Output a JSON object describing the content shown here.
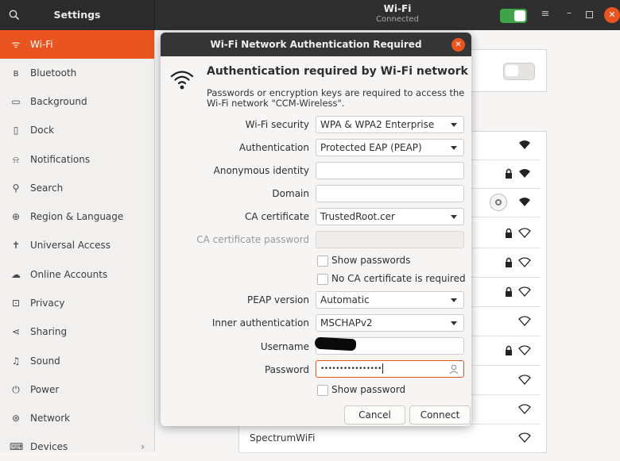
{
  "header": {
    "settings_title": "Settings",
    "window_title": "Wi-Fi",
    "window_subtitle": "Connected",
    "menu_glyph": "≡",
    "minimize_glyph": "–",
    "close_glyph": "✕"
  },
  "sidebar": {
    "items": [
      {
        "label": "Wi-Fi",
        "icon": "wifi-icon",
        "glyph": "ᯤ"
      },
      {
        "label": "Bluetooth",
        "icon": "bluetooth-icon",
        "glyph": "ʙ"
      },
      {
        "label": "Background",
        "icon": "background-icon",
        "glyph": "▭"
      },
      {
        "label": "Dock",
        "icon": "dock-icon",
        "glyph": "▯"
      },
      {
        "label": "Notifications",
        "icon": "bell-icon",
        "glyph": "⍾"
      },
      {
        "label": "Search",
        "icon": "search-icon",
        "glyph": "⚲"
      },
      {
        "label": "Region & Language",
        "icon": "globe-icon",
        "glyph": "⊕"
      },
      {
        "label": "Universal Access",
        "icon": "accessibility-icon",
        "glyph": "✝"
      },
      {
        "label": "Online Accounts",
        "icon": "cloud-icon",
        "glyph": "☁"
      },
      {
        "label": "Privacy",
        "icon": "privacy-icon",
        "glyph": "⊡"
      },
      {
        "label": "Sharing",
        "icon": "share-icon",
        "glyph": "⋖"
      },
      {
        "label": "Sound",
        "icon": "music-icon",
        "glyph": "♫"
      },
      {
        "label": "Power",
        "icon": "power-icon",
        "glyph": "⏻"
      },
      {
        "label": "Network",
        "icon": "network-icon",
        "glyph": "⊛"
      },
      {
        "label": "Devices",
        "icon": "devices-icon",
        "glyph": "⌨"
      }
    ],
    "chevron": "›"
  },
  "background_network": {
    "last_visible_network": "SpectrumWiFi"
  },
  "dialog": {
    "title": "Wi-Fi Network Authentication Required",
    "heading": "Authentication required by Wi-Fi network",
    "description": "Passwords or encryption keys are required to access the Wi-Fi network \"CCM-Wireless\".",
    "fields": {
      "wifi_security": {
        "label": "Wi-Fi security",
        "value": "WPA & WPA2 Enterprise"
      },
      "authentication": {
        "label": "Authentication",
        "value": "Protected EAP (PEAP)"
      },
      "anonymous_identity": {
        "label": "Anonymous identity",
        "value": ""
      },
      "domain": {
        "label": "Domain",
        "value": ""
      },
      "ca_certificate": {
        "label": "CA certificate",
        "value": "TrustedRoot.cer"
      },
      "ca_certificate_password": {
        "label": "CA certificate password",
        "value": ""
      },
      "show_passwords": {
        "label": "Show passwords"
      },
      "no_ca_required": {
        "label": "No CA certificate is required"
      },
      "peap_version": {
        "label": "PEAP version",
        "value": "Automatic"
      },
      "inner_auth": {
        "label": "Inner authentication",
        "value": "MSCHAPv2"
      },
      "username": {
        "label": "Username",
        "value": ""
      },
      "password": {
        "label": "Password",
        "value": "••••••••••••••••"
      },
      "show_password": {
        "label": "Show password"
      }
    },
    "cancel_label": "Cancel",
    "connect_label": "Connect",
    "close_glyph": "✕"
  },
  "colors": {
    "accent": "#e95420",
    "toggle_on": "#3fa34a",
    "header_bg": "#2f2f2f"
  }
}
